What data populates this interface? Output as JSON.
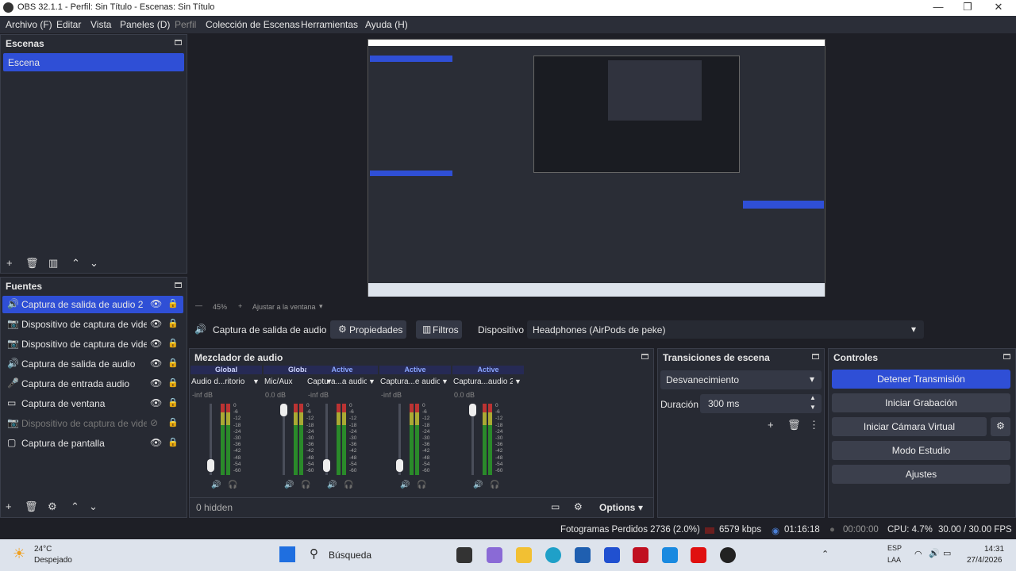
{
  "window": {
    "title": "OBS 32.1.1 - Perfil: Sin Título - Escenas: Sin Título",
    "minimize": "—",
    "maximize": "❐",
    "close": "✕"
  },
  "menu": [
    "Archivo (F)",
    "Editar",
    "Vista",
    "Paneles (D)",
    "Perfil",
    "Colección de Escenas",
    "Herramientas",
    "Ayuda (H)"
  ],
  "scenes": {
    "title": "Escenas",
    "items": [
      "Escena"
    ]
  },
  "sources": {
    "title": "Fuentes",
    "items": [
      {
        "label": "Captura de salida de audio 2",
        "icon": "speaker-icon"
      },
      {
        "label": "Dispositivo de captura de video",
        "icon": "camera-icon"
      },
      {
        "label": "Dispositivo de captura de video",
        "icon": "camera-icon"
      },
      {
        "label": "Captura de salida de audio",
        "icon": "speaker-icon"
      },
      {
        "label": "Captura de entrada audio",
        "icon": "microphone-icon"
      },
      {
        "label": "Captura de ventana",
        "icon": "window-icon"
      },
      {
        "label": "Dispositivo de captura de video",
        "icon": "camera-icon",
        "hidden": true
      },
      {
        "label": "Captura de pantalla",
        "icon": "monitor-icon"
      }
    ]
  },
  "preview": {
    "zoom": "45%",
    "fit": "Ajustar a la ventana"
  },
  "source_toolbar": {
    "selected": "Captura de salida de audio",
    "properties": "Propiedades",
    "filters": "Filtros",
    "device_label": "Dispositivo",
    "device_value": "Headphones (AirPods de peke)"
  },
  "mixer": {
    "title": "Mezclador de audio",
    "hidden": "0 hidden",
    "options": "Options",
    "channels": [
      {
        "head": "Global",
        "name": "Audio d...ritorio",
        "db": "-inf dB",
        "fader": 0.05
      },
      {
        "head": "Global",
        "name": "Mic/Aux",
        "db": "0.0 dB",
        "fader": 1.0
      },
      {
        "head": "Active",
        "name": "Captura...a audio",
        "db": "-inf dB",
        "fader": 0.05
      },
      {
        "head": "Active",
        "name": "Captura...e audio",
        "db": "-inf dB",
        "fader": 0.05
      },
      {
        "head": "Active",
        "name": "Captura...audio 2",
        "db": "0.0 dB",
        "fader": 1.0
      }
    ],
    "scale": [
      "0",
      "-6",
      "-12",
      "-18",
      "-24",
      "-30",
      "-36",
      "-42",
      "-48",
      "-54",
      "-60"
    ]
  },
  "transitions": {
    "title": "Transiciones de escena",
    "selected": "Desvanecimiento",
    "duration_label": "Duración",
    "duration_value": "300 ms"
  },
  "controls": {
    "title": "Controles",
    "buttons": [
      "Detener Transmisión",
      "Iniciar Grabación",
      "Iniciar Cámara Virtual",
      "Modo Estudio",
      "Ajustes"
    ]
  },
  "status": {
    "dropped": "Fotogramas Perdidos 2736 (2.0%)",
    "bitrate": "6579 kbps",
    "stream_time": "01:16:18",
    "rec_time": "00:00:00",
    "cpu": "CPU: 4.7%",
    "fps": "30.00 / 30.00 FPS"
  },
  "taskbar": {
    "temp": "24°C",
    "weather": "Despejado",
    "search": "Búsqueda",
    "lang1": "ESP",
    "lang2": "LAA",
    "time": "14:31",
    "date": "27/4/2026"
  },
  "colors": {
    "accent": "#2f4fd6",
    "selected_row": "#2f4fd6",
    "panel": "#272a33"
  }
}
